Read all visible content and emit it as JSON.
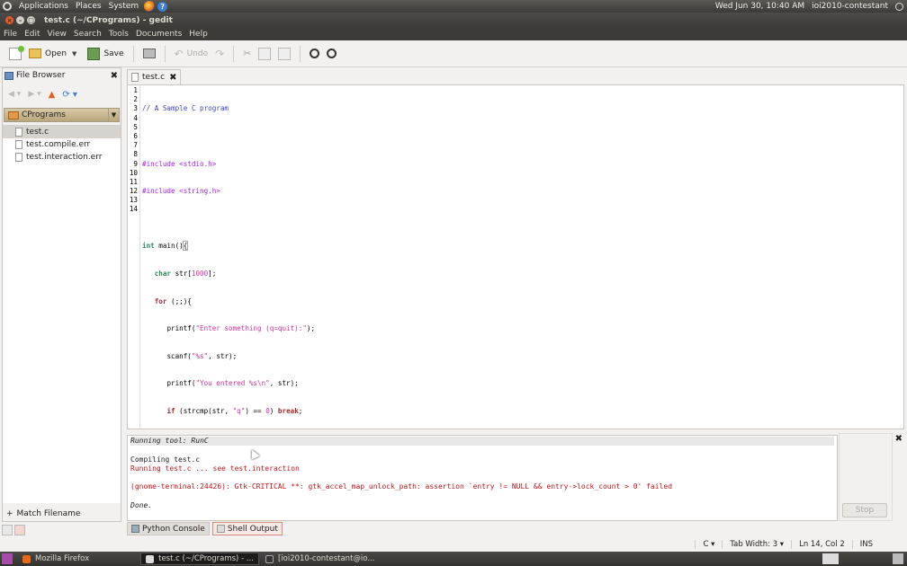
{
  "topbar": {
    "applications": "Applications",
    "places": "Places",
    "system": "System",
    "datetime": "Wed Jun 30, 10:40 AM",
    "user": "ioi2010-contestant"
  },
  "window": {
    "title": "test.c (~/CPrograms) - gedit"
  },
  "menu": {
    "file": "File",
    "edit": "Edit",
    "view": "View",
    "search": "Search",
    "tools": "Tools",
    "documents": "Documents",
    "help": "Help"
  },
  "toolbar": {
    "open": "Open",
    "save": "Save",
    "undo": "Undo"
  },
  "sidebar": {
    "title": "File Browser",
    "folder": "CPrograms",
    "files": [
      "test.c",
      "test.compile.err",
      "test.interaction.err"
    ],
    "match_filename": "Match Filename"
  },
  "editor": {
    "tab": "test.c",
    "line_numbers": [
      "1",
      "2",
      "3",
      "4",
      "5",
      "6",
      "7",
      "8",
      "9",
      "10",
      "11",
      "12",
      "13",
      "14"
    ]
  },
  "code": {
    "l1": "// A Sample C program",
    "l3": "#include <stdio.h>",
    "l4": "#include <string.h>",
    "l6_kw": "int",
    "l6_rest": " main()",
    "l6_brace": "{",
    "l7_kw": "char",
    "l7_a": " str[",
    "l7_num": "1000",
    "l7_b": "];",
    "l8_kw": "for",
    "l8_rest": " (;;){",
    "l9_a": "printf(",
    "l9_str": "\"Enter something (q=quit):\"",
    "l9_b": ");",
    "l10_a": "scanf(",
    "l10_str": "\"%s\"",
    "l10_b": ", str);",
    "l11_a": "printf(",
    "l11_str": "\"You entered %s\\n\"",
    "l11_b": ", str);",
    "l12_kw": "if",
    "l12_a": " (strcmp(str, ",
    "l12_str": "\"q\"",
    "l12_b": ") == ",
    "l12_num": "0",
    "l12_c": ") ",
    "l12_kw2": "break",
    "l12_d": ";",
    "l13": "}",
    "l14": "}"
  },
  "output": {
    "running": "Running tool: RunC",
    "compiling": "Compiling test.c",
    "running_file": "Running test.c ... see test.interaction",
    "error": "(gnome-terminal:24426): Gtk-CRITICAL **: gtk_accel_map_unlock_path: assertion `entry != NULL && entry->lock_count > 0' failed",
    "done": "Done.",
    "stop": "Stop"
  },
  "bottom_tabs": {
    "python": "Python Console",
    "shell": "Shell Output"
  },
  "status": {
    "language": "C",
    "tab_width": "Tab Width:  3",
    "position": "Ln 14, Col 2",
    "mode": "INS"
  },
  "taskbar": {
    "firefox": "Mozilla Firefox",
    "gedit": "test.c (~/CPrograms) - ...",
    "terminal": "[ioi2010-contestant@io..."
  }
}
